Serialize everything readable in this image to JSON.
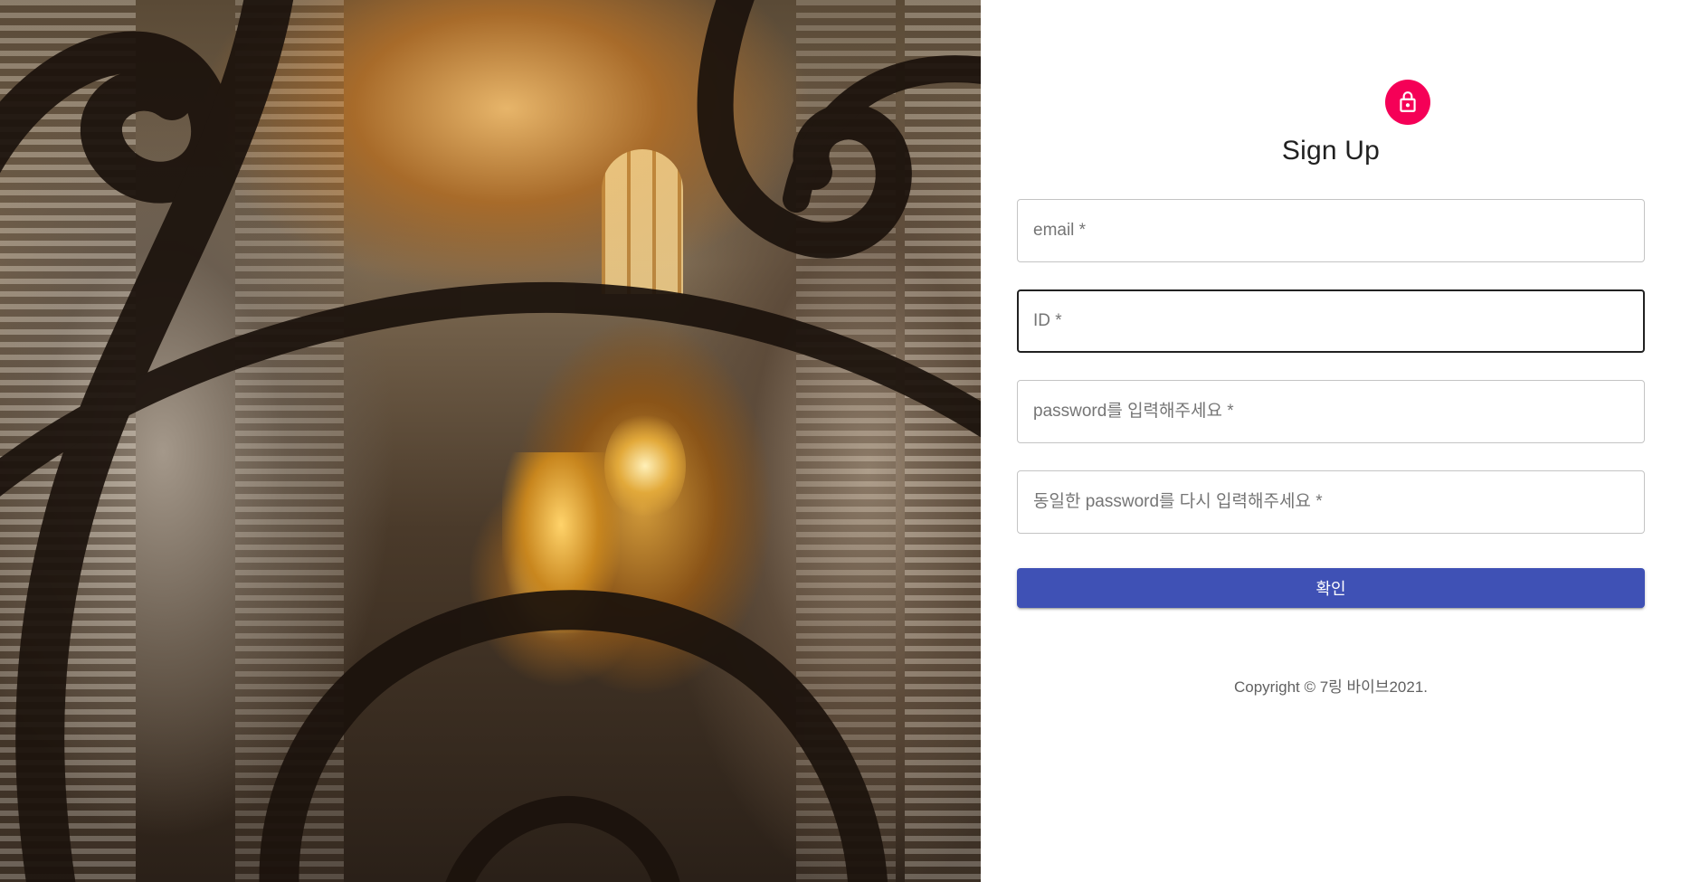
{
  "hero": {
    "image_icon": "ornate-church-interior-through-wrought-iron-image"
  },
  "form": {
    "icon": "lock-icon",
    "accent_color": "#f50057",
    "title": "Sign Up",
    "fields": {
      "email": {
        "placeholder": "email *",
        "value": ""
      },
      "id": {
        "placeholder": "ID *",
        "value": "",
        "focused": true
      },
      "password": {
        "placeholder": "password를 입력해주세요 *",
        "value": ""
      },
      "password_confirm": {
        "placeholder": "동일한 password를 다시 입력해주세요 *",
        "value": ""
      }
    },
    "submit_label": "확인",
    "submit_color": "#3f51b5"
  },
  "footer": {
    "prefix": "Copyright © ",
    "link_text": "7링 바이브",
    "suffix": "2021."
  }
}
